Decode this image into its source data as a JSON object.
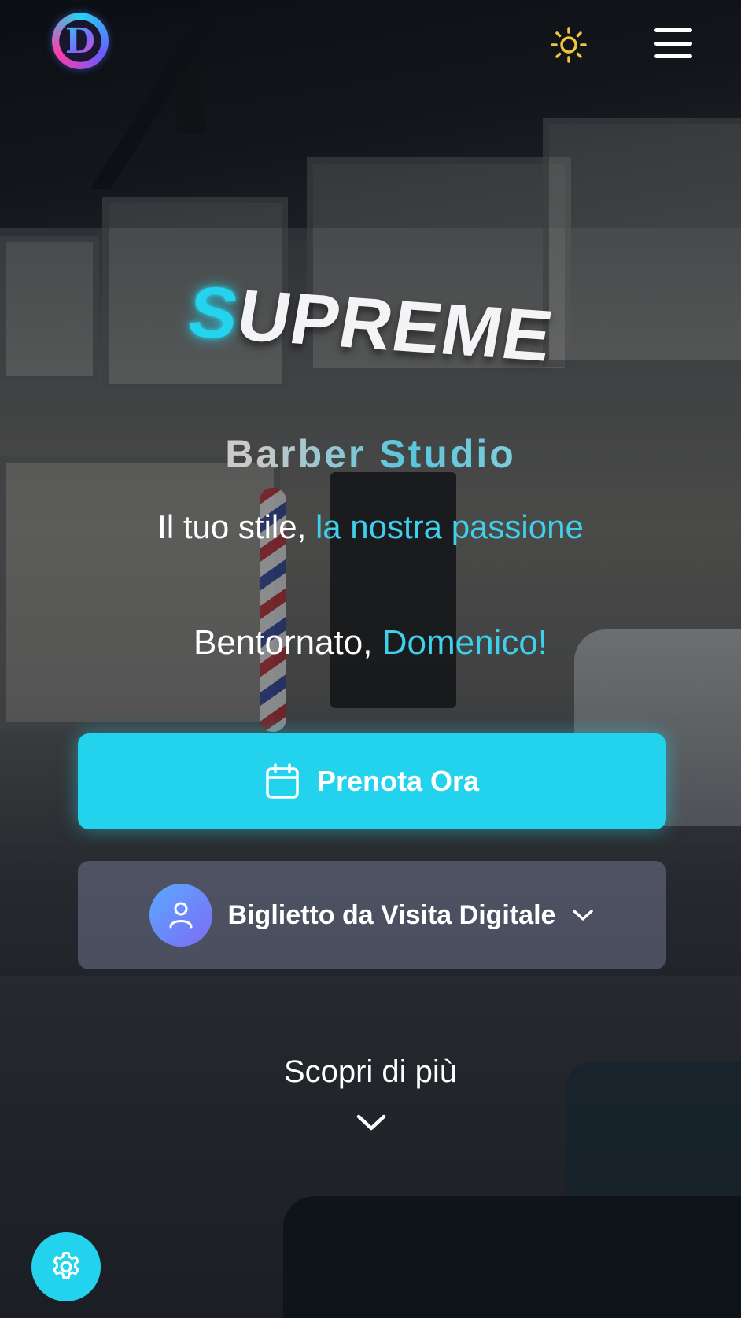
{
  "header": {
    "logo_letter": "D",
    "theme_icon": "sun-icon",
    "menu_icon": "hamburger-menu-icon"
  },
  "hero": {
    "brand_first": "S",
    "brand_rest": "UPREME",
    "subtitle": "Barber Studio",
    "tagline_plain": "Il tuo stile, ",
    "tagline_accent": "la nostra passione",
    "welcome_plain": "Bentornato, ",
    "welcome_name": "Domenico!"
  },
  "actions": {
    "book_label": "Prenota Ora",
    "book_icon": "calendar-icon",
    "card_label": "Biglietto da Visita Digitale",
    "card_icon": "user-icon",
    "card_chevron": "chevron-down-icon"
  },
  "discover": {
    "label": "Scopri di più",
    "icon": "chevron-down-icon"
  },
  "fab": {
    "icon": "gear-icon"
  },
  "colors": {
    "accent": "#23d3ee",
    "sun": "#f2c43b",
    "card_bg": "#6e738c",
    "avatar_start": "#5aa9ff",
    "avatar_end": "#7d6bf5"
  }
}
